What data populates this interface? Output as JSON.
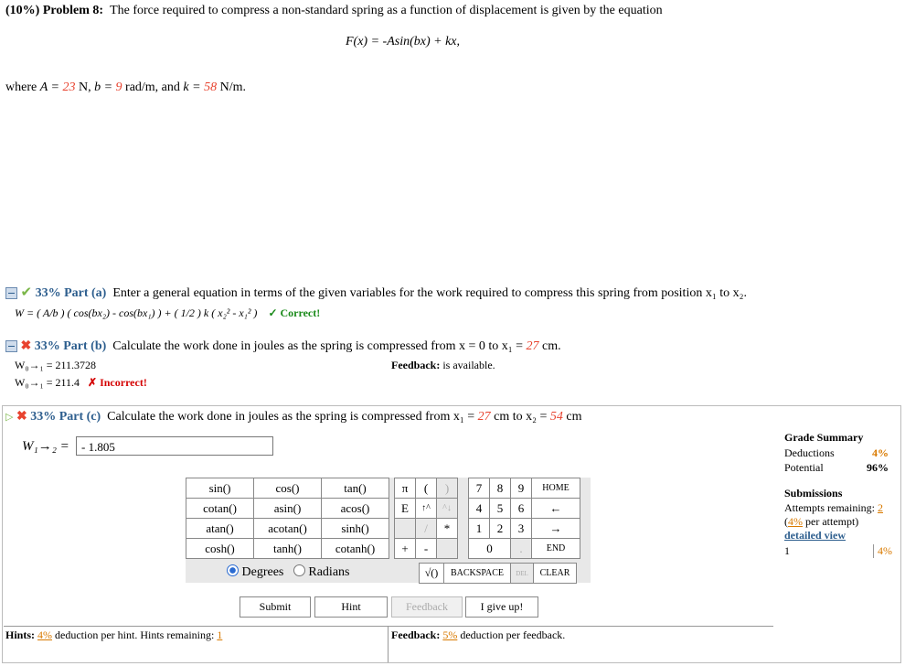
{
  "problem": {
    "weight": "(10%)",
    "label": "Problem 8:",
    "text": "The force required to compress a non-standard spring as a function of displacement is given by the equation",
    "equation": "F(x) = -Asin(bx) + kx,",
    "where_prefix": "where",
    "A_label": "A =",
    "A_value": "23",
    "A_unit": "N,",
    "b_label": "b =",
    "b_value": "9",
    "b_unit": "rad/m, and",
    "k_label": "k =",
    "k_value": "58",
    "k_unit": "N/m."
  },
  "part_a": {
    "percent_label": "33% Part (a)",
    "text": "Enter a general equation in terms of the given variables for the work required to compress this spring from position x₁ to x₂.",
    "answer": "W = ( A/b ) ( cos(bx₂) - cos(bx₁) ) + ( 1/2 ) k ( x₂² - x₁² )",
    "status": "✓ Correct!"
  },
  "part_b": {
    "percent_label": "33% Part (b)",
    "text_prefix": "Calculate the work done in joules as the spring is compressed from x = 0 to x₁ =",
    "x1_value": "27",
    "x1_unit": "cm.",
    "answer1": "W₀→₁ = 211.3728",
    "feedback_label": "Feedback:",
    "feedback_text": "is available.",
    "answer2": "W₀→₁ = 211.4",
    "status": "✗ Incorrect!"
  },
  "part_c": {
    "percent_label": "33% Part (c)",
    "text_prefix": "Calculate the work done in joules as the spring is compressed from x₁ =",
    "x1_value": "27",
    "text_mid": "cm to x₂ =",
    "x2_value": "54",
    "x2_unit": "cm",
    "input_label": "W₁→₂ =",
    "input_value": "- 1.805"
  },
  "calculator": {
    "functions": [
      [
        "sin()",
        "cos()",
        "tan()"
      ],
      [
        "cotan()",
        "asin()",
        "acos()"
      ],
      [
        "atan()",
        "acotan()",
        "sinh()"
      ],
      [
        "cosh()",
        "tanh()",
        "cotanh()"
      ]
    ],
    "mode_degrees": "Degrees",
    "mode_radians": "Radians",
    "symbols": [
      [
        "π",
        "(",
        ")"
      ],
      [
        "E",
        "↑^",
        "^↓"
      ],
      [
        "",
        "/",
        "*"
      ],
      [
        "+",
        "-",
        ""
      ]
    ],
    "digits": [
      [
        "7",
        "8",
        "9",
        "HOME"
      ],
      [
        "4",
        "5",
        "6",
        "←"
      ],
      [
        "1",
        "2",
        "3",
        "→"
      ],
      [
        "0",
        ".",
        "",
        "END"
      ]
    ],
    "sqrt": "√()",
    "backspace": "BACKSPACE",
    "del": "DEL",
    "clear": "CLEAR"
  },
  "buttons": {
    "submit": "Submit",
    "hint": "Hint",
    "feedback": "Feedback",
    "give_up": "I give up!"
  },
  "hints": {
    "label": "Hints:",
    "percent": "4%",
    "text": "deduction per hint. Hints remaining:",
    "remaining": "1"
  },
  "feedback_bar": {
    "label": "Feedback:",
    "percent": "5%",
    "text": "deduction per feedback."
  },
  "grade_summary": {
    "title": "Grade Summary",
    "deductions_label": "Deductions",
    "deductions_value": "4%",
    "potential_label": "Potential",
    "potential_value": "96%",
    "submissions_title": "Submissions",
    "attempts_label": "Attempts remaining:",
    "attempts_value": "2",
    "per_attempt_percent": "4%",
    "per_attempt_text": "per attempt)",
    "detailed_view": "detailed view",
    "row_number": "1",
    "row_value": "4%"
  }
}
